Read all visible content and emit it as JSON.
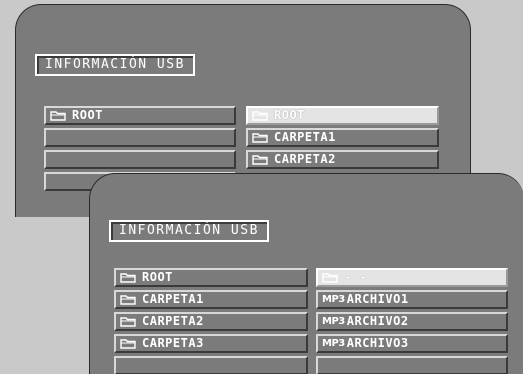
{
  "back_screen": {
    "title": "INFORMACIÓN USB",
    "left_items": [
      {
        "icon": "folder-icon",
        "label": "ROOT"
      },
      {
        "label": ""
      },
      {
        "label": ""
      },
      {
        "label": ""
      }
    ],
    "right_items": [
      {
        "icon": "folder-icon",
        "label": "ROOT",
        "selected": true
      },
      {
        "icon": "folder-icon",
        "label": "CARPETA1"
      },
      {
        "icon": "folder-icon",
        "label": "CARPETA2"
      }
    ]
  },
  "front_screen": {
    "title": "INFORMACIÓN USB",
    "left_items": [
      {
        "icon": "folder-icon",
        "label": "ROOT"
      },
      {
        "icon": "folder-icon",
        "label": "CARPETA1"
      },
      {
        "icon": "folder-icon",
        "label": "CARPETA2"
      },
      {
        "icon": "folder-icon",
        "label": "CARPETA3"
      },
      {
        "label": ""
      }
    ],
    "right_items": [
      {
        "icon": "folder-icon",
        "label": "- -",
        "selected": true
      },
      {
        "prefix": "MP3",
        "label": "ARCHIVO1"
      },
      {
        "prefix": "MP3",
        "label": "ARCHIVO2"
      },
      {
        "prefix": "MP3",
        "label": "ARCHIVO3"
      },
      {
        "label": ""
      }
    ]
  }
}
